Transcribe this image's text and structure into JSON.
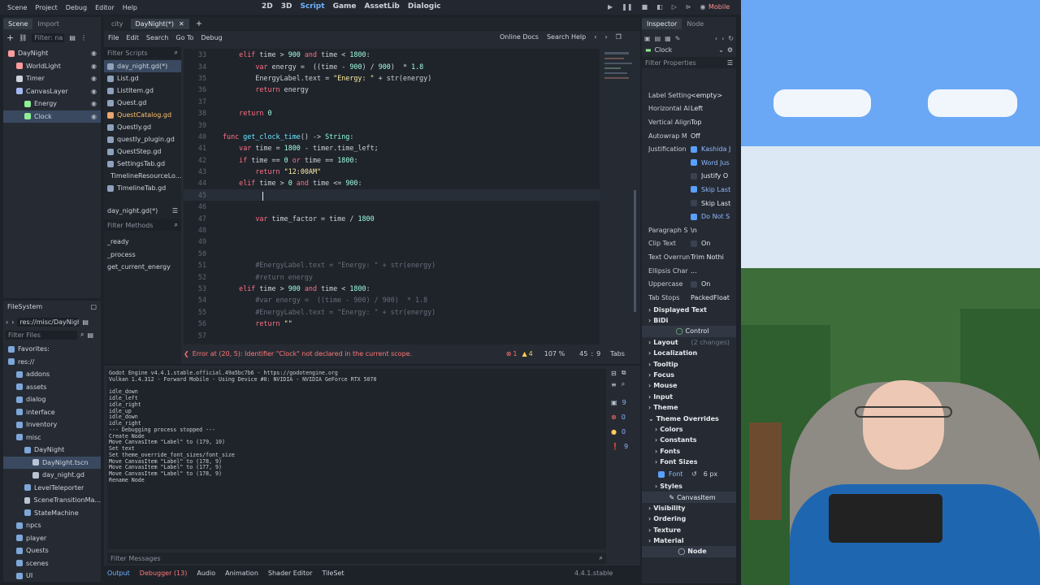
{
  "menu": [
    "Scene",
    "Project",
    "Debug",
    "Editor",
    "Help"
  ],
  "workspaces": [
    "2D",
    "3D",
    "Script",
    "Game",
    "AssetLib",
    "Dialogic"
  ],
  "renderer": "Mobile",
  "scene_dock": {
    "tabs": [
      "Scene",
      "Import"
    ],
    "filter_placeholder": "Filter: na",
    "nodes": [
      {
        "name": "DayNight",
        "depth": 0
      },
      {
        "name": "WorldLight",
        "depth": 1
      },
      {
        "name": "Timer",
        "depth": 1
      },
      {
        "name": "CanvasLayer",
        "depth": 1
      },
      {
        "name": "Energy",
        "depth": 2
      },
      {
        "name": "Clock",
        "depth": 2,
        "selected": true
      }
    ]
  },
  "filesystem": {
    "title": "FileSystem",
    "path": "res://misc/DayNight",
    "filter_placeholder": "Filter Files",
    "items": [
      {
        "name": "Favorites:",
        "depth": 0
      },
      {
        "name": "res://",
        "depth": 0
      },
      {
        "name": "addons",
        "depth": 1
      },
      {
        "name": "assets",
        "depth": 1
      },
      {
        "name": "dialog",
        "depth": 1
      },
      {
        "name": "interface",
        "depth": 1
      },
      {
        "name": "Inventory",
        "depth": 1
      },
      {
        "name": "misc",
        "depth": 1
      },
      {
        "name": "DayNight",
        "depth": 2
      },
      {
        "name": "DayNight.tscn",
        "depth": 3,
        "selected": true
      },
      {
        "name": "day_night.gd",
        "depth": 3
      },
      {
        "name": "LevelTeleporter",
        "depth": 2
      },
      {
        "name": "SceneTransitionMa...",
        "depth": 2
      },
      {
        "name": "StateMachine",
        "depth": 2
      },
      {
        "name": "npcs",
        "depth": 1
      },
      {
        "name": "player",
        "depth": 1
      },
      {
        "name": "Quests",
        "depth": 1
      },
      {
        "name": "scenes",
        "depth": 1
      },
      {
        "name": "UI",
        "depth": 1
      }
    ]
  },
  "editor_tabs": [
    "city",
    "DayNight(*)"
  ],
  "script_menu": [
    "File",
    "Edit",
    "Search",
    "Go To",
    "Debug"
  ],
  "online_docs": "Online Docs",
  "search_help": "Search Help",
  "filter_scripts": "Filter Scripts",
  "scripts": [
    "day_night.gd(*)",
    "List.gd",
    "ListItem.gd",
    "Quest.gd",
    "QuestCatalog.gd",
    "Questly.gd",
    "questly_plugin.gd",
    "QuestStep.gd",
    "SettingsTab.gd",
    "TimelineResourceLo...",
    "TimelineTab.gd"
  ],
  "current_script": "day_night.gd(*)",
  "filter_methods": "Filter Methods",
  "methods": [
    "_ready",
    "_process",
    "get_current_energy"
  ],
  "code": [
    {
      "n": "33",
      "t": "\telif time > 900 and time < 1800:"
    },
    {
      "n": "34",
      "t": "\t\tvar energy =  ((time - 900) / 900)  * 1.8"
    },
    {
      "n": "35",
      "t": "\t\tEnergyLabel.text = \"Energy: \" + str(energy)"
    },
    {
      "n": "36",
      "t": "\t\treturn energy"
    },
    {
      "n": "37",
      "t": ""
    },
    {
      "n": "38",
      "t": "\treturn 0"
    },
    {
      "n": "39",
      "t": ""
    },
    {
      "n": "40",
      "t": "func get_clock_time() -> String:"
    },
    {
      "n": "41",
      "t": "\tvar time = 1800 - timer.time_left;"
    },
    {
      "n": "42",
      "t": "\tif time == 0 or time == 1800:"
    },
    {
      "n": "43",
      "t": "\t\treturn \"12:00AM\""
    },
    {
      "n": "44",
      "t": "\telif time > 0 and time <= 900:"
    },
    {
      "n": "45",
      "t": "\t\t"
    },
    {
      "n": "46",
      "t": ""
    },
    {
      "n": "47",
      "t": "\t\tvar time_factor = time / 1800"
    },
    {
      "n": "48",
      "t": ""
    },
    {
      "n": "49",
      "t": ""
    },
    {
      "n": "50",
      "t": ""
    },
    {
      "n": "51",
      "t": "\t\t#EnergyLabel.text = \"Energy: \" + str(energy)"
    },
    {
      "n": "52",
      "t": "\t\t#return energy"
    },
    {
      "n": "53",
      "t": "\telif time > 900 and time < 1800:"
    },
    {
      "n": "54",
      "t": "\t\t#var energy =  ((time - 900) / 900)  * 1.8"
    },
    {
      "n": "55",
      "t": "\t\t#EnergyLabel.text = \"Energy: \" + str(energy)"
    },
    {
      "n": "56",
      "t": "\t\treturn \"\""
    },
    {
      "n": "57",
      "t": ""
    }
  ],
  "status": {
    "error": "Error at (20, 5): Identifier \"Clock\" not declared in the current scope.",
    "errors": "1",
    "warnings": "4",
    "zoom": "107 %",
    "line": "45",
    "col": "9",
    "indent": "Tabs"
  },
  "output": [
    "Godot Engine v4.4.1.stable.official.49a5bc7b6 - https://godotengine.org",
    "Vulkan 1.4.312 - Forward Mobile - Using Device #0: NVIDIA - NVIDIA GeForce RTX 5070",
    "",
    "idle_down",
    "idle_left",
    "idle_right",
    "idle_up",
    "idle_down",
    "idle_right",
    "--- Debugging process stopped ---",
    "Create Node",
    "Move CanvasItem \"Label\" to (179, 10)",
    "Set text",
    "Set theme_override_font_sizes/font_size",
    "Move CanvasItem \"Label\" to (178, 9)",
    "Move CanvasItem \"Label\" to (177, 9)",
    "Move CanvasItem \"Label\" to (178, 9)",
    "Rename Node"
  ],
  "output_counts": [
    "9",
    "0",
    "0",
    "9"
  ],
  "filter_messages": "Filter Messages",
  "bottom_tabs": [
    "Output",
    "Debugger (13)",
    "Audio",
    "Animation",
    "Shader Editor",
    "TileSet"
  ],
  "version": "4.4.1.stable",
  "inspector": {
    "tabs": [
      "Inspector",
      "Node"
    ],
    "node": "Clock",
    "filter": "Filter Properties",
    "props": [
      {
        "label": "Label Setting",
        "value": "<empty>"
      },
      {
        "label": "Horizontal Al",
        "value": "Left"
      },
      {
        "label": "Vertical Align",
        "value": "Top"
      },
      {
        "label": "Autowrap M",
        "value": "Off"
      },
      {
        "label": "Justification",
        "value": "Kashida J",
        "check": true
      },
      {
        "label": "",
        "value": "Word Jus",
        "check": true
      },
      {
        "label": "",
        "value": "Justify O",
        "check": false
      },
      {
        "label": "",
        "value": "Skip Last",
        "check": true
      },
      {
        "label": "",
        "value": "Skip Last",
        "check": false
      },
      {
        "label": "",
        "value": "Do Not S",
        "check": true
      },
      {
        "label": "Paragraph S",
        "value": "\\n"
      },
      {
        "label": "Clip Text",
        "value": "On",
        "check": false
      },
      {
        "label": "Text Overrun",
        "value": "Trim Nothi"
      },
      {
        "label": "Ellipsis Char",
        "value": "..."
      },
      {
        "label": "Uppercase",
        "value": "On",
        "check": false
      },
      {
        "label": "Tab Stops",
        "value": "PackedFloat"
      }
    ],
    "sections": [
      "Displayed Text",
      "BiDi"
    ],
    "control_header": "Control",
    "layout": "Layout",
    "layout_hint": "(2 changes)",
    "control_sections": [
      "Localization",
      "Tooltip",
      "Focus",
      "Mouse",
      "Input",
      "Theme"
    ],
    "theme_overrides": "Theme Overrides",
    "overrides": [
      "Colors",
      "Constants",
      "Fonts",
      "Font Sizes"
    ],
    "font_size_label": "Font",
    "font_size_value": "6 px",
    "styles": "Styles",
    "canvas_item": "CanvasItem",
    "canvas_sections": [
      "Visibility",
      "Ordering",
      "Texture",
      "Material"
    ],
    "node_footer": "Node"
  }
}
